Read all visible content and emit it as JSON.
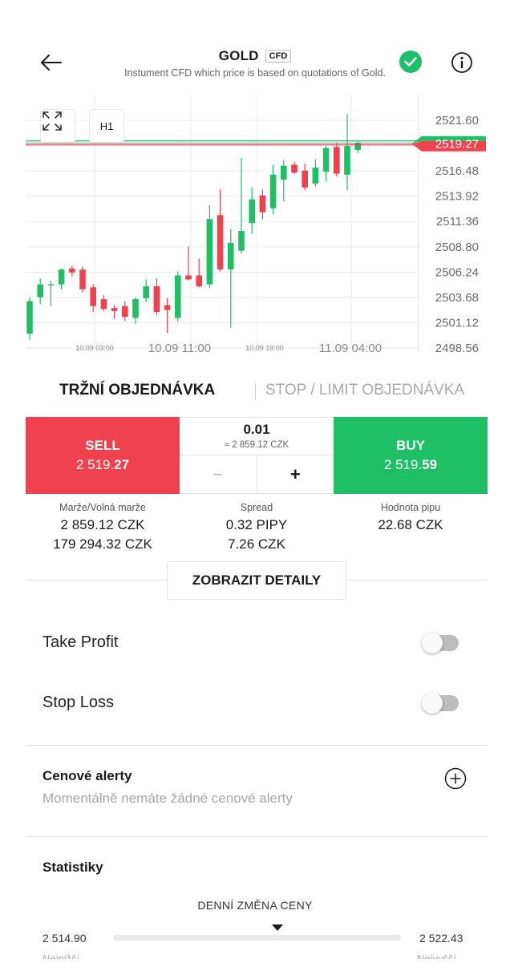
{
  "header": {
    "title": "GOLD",
    "badge": "CFD",
    "subtitle": "Instument CFD which price is based on quotations of Gold."
  },
  "chart_data": {
    "type": "candlestick",
    "timeframe": "H1",
    "y_ticks": [
      "2521.60",
      "2519.27",
      "2516.48",
      "2513.92",
      "2511.36",
      "2508.80",
      "2506.24",
      "2503.68",
      "2501.12",
      "2498.56"
    ],
    "ylim": [
      2498.56,
      2521.6
    ],
    "x_labels_major": [
      "10.09 11:00",
      "11.09 04:00"
    ],
    "x_labels_minor": [
      "10.09 03:00",
      "10.09 19:00"
    ],
    "current_price": "2519.27",
    "colors": {
      "up": "#1ebf65",
      "down": "#f0414f",
      "grid": "#ececec"
    },
    "candles": [
      {
        "o": 2500.0,
        "h": 2503.7,
        "l": 2499.4,
        "c": 2503.3
      },
      {
        "o": 2503.7,
        "h": 2505.6,
        "l": 2503.0,
        "c": 2505.0
      },
      {
        "o": 2505.0,
        "h": 2505.4,
        "l": 2502.8,
        "c": 2505.0
      },
      {
        "o": 2505.0,
        "h": 2506.6,
        "l": 2504.5,
        "c": 2506.5
      },
      {
        "o": 2506.6,
        "h": 2506.9,
        "l": 2505.8,
        "c": 2506.2
      },
      {
        "o": 2506.5,
        "h": 2506.8,
        "l": 2504.2,
        "c": 2504.5
      },
      {
        "o": 2504.7,
        "h": 2505.0,
        "l": 2502.2,
        "c": 2502.8
      },
      {
        "o": 2503.5,
        "h": 2503.9,
        "l": 2502.3,
        "c": 2502.5
      },
      {
        "o": 2502.6,
        "h": 2502.9,
        "l": 2501.5,
        "c": 2502.3
      },
      {
        "o": 2502.8,
        "h": 2503.3,
        "l": 2501.3,
        "c": 2501.7
      },
      {
        "o": 2501.6,
        "h": 2503.7,
        "l": 2501.0,
        "c": 2503.5
      },
      {
        "o": 2503.6,
        "h": 2505.5,
        "l": 2503.2,
        "c": 2504.8
      },
      {
        "o": 2504.8,
        "h": 2505.6,
        "l": 2501.9,
        "c": 2502.2
      },
      {
        "o": 2502.9,
        "h": 2503.6,
        "l": 2500.1,
        "c": 2502.4
      },
      {
        "o": 2501.6,
        "h": 2506.3,
        "l": 2501.2,
        "c": 2505.9
      },
      {
        "o": 2505.9,
        "h": 2508.8,
        "l": 2505.4,
        "c": 2505.5
      },
      {
        "o": 2505.9,
        "h": 2507.6,
        "l": 2504.7,
        "c": 2504.8
      },
      {
        "o": 2505.0,
        "h": 2513.0,
        "l": 2504.6,
        "c": 2511.6
      },
      {
        "o": 2512.0,
        "h": 2514.6,
        "l": 2506.3,
        "c": 2506.5
      },
      {
        "o": 2506.5,
        "h": 2510.6,
        "l": 2500.6,
        "c": 2509.2
      },
      {
        "o": 2508.4,
        "h": 2517.8,
        "l": 2508.1,
        "c": 2510.4
      },
      {
        "o": 2511.2,
        "h": 2514.8,
        "l": 2510.1,
        "c": 2513.6
      },
      {
        "o": 2514.0,
        "h": 2514.6,
        "l": 2511.6,
        "c": 2512.3
      },
      {
        "o": 2512.7,
        "h": 2517.1,
        "l": 2512.1,
        "c": 2516.1
      },
      {
        "o": 2515.6,
        "h": 2517.6,
        "l": 2513.4,
        "c": 2517.0
      },
      {
        "o": 2517.1,
        "h": 2517.4,
        "l": 2516.1,
        "c": 2516.3
      },
      {
        "o": 2516.5,
        "h": 2517.2,
        "l": 2514.5,
        "c": 2514.8
      },
      {
        "o": 2515.2,
        "h": 2517.6,
        "l": 2514.9,
        "c": 2516.8
      },
      {
        "o": 2516.4,
        "h": 2519.0,
        "l": 2515.4,
        "c": 2518.8
      },
      {
        "o": 2518.9,
        "h": 2519.3,
        "l": 2515.9,
        "c": 2516.2
      },
      {
        "o": 2516.1,
        "h": 2522.2,
        "l": 2514.5,
        "c": 2519.0
      },
      {
        "o": 2518.6,
        "h": 2519.5,
        "l": 2518.3,
        "c": 2519.3
      }
    ]
  },
  "tabs": {
    "active": "TRŽNÍ OBJEDNÁVKA",
    "inactive": "STOP / LIMIT OBJEDNÁVKA"
  },
  "order": {
    "sell_label": "SELL",
    "sell_price_main": "2 519.",
    "sell_price_bold": "27",
    "buy_label": "BUY",
    "buy_price_main": "2 519.",
    "buy_price_bold": "59",
    "volume": "0.01",
    "volume_value": "≈ 2 859.12 CZK",
    "minus": "−",
    "plus": "+"
  },
  "info": {
    "margin_label": "Marže/Volná marže",
    "margin_value": "2 859.12  CZK",
    "free_margin_value": "179 294.32  CZK",
    "spread_label": "Spread",
    "spread_pips": "0.32  PIPY",
    "spread_czk": "7.26  CZK",
    "pip_label": "Hodnota pipu",
    "pip_value": "22.68  CZK"
  },
  "details_button": "ZOBRAZIT DETAILY",
  "take_profit": {
    "label": "Take Profit",
    "enabled": false
  },
  "stop_loss": {
    "label": "Stop Loss",
    "enabled": false
  },
  "alerts": {
    "title": "Cenové alerty",
    "empty_text": "Momentálně nemáte žádné cenové alerty"
  },
  "stats": {
    "title": "Statistiky",
    "range_title": "DENNÍ ZMĚNA CENY",
    "low": "2 514.90",
    "high": "2 522.43",
    "current_fraction": 0.57,
    "low_label": "Nejnižší",
    "high_label": "Nejvyšší"
  }
}
